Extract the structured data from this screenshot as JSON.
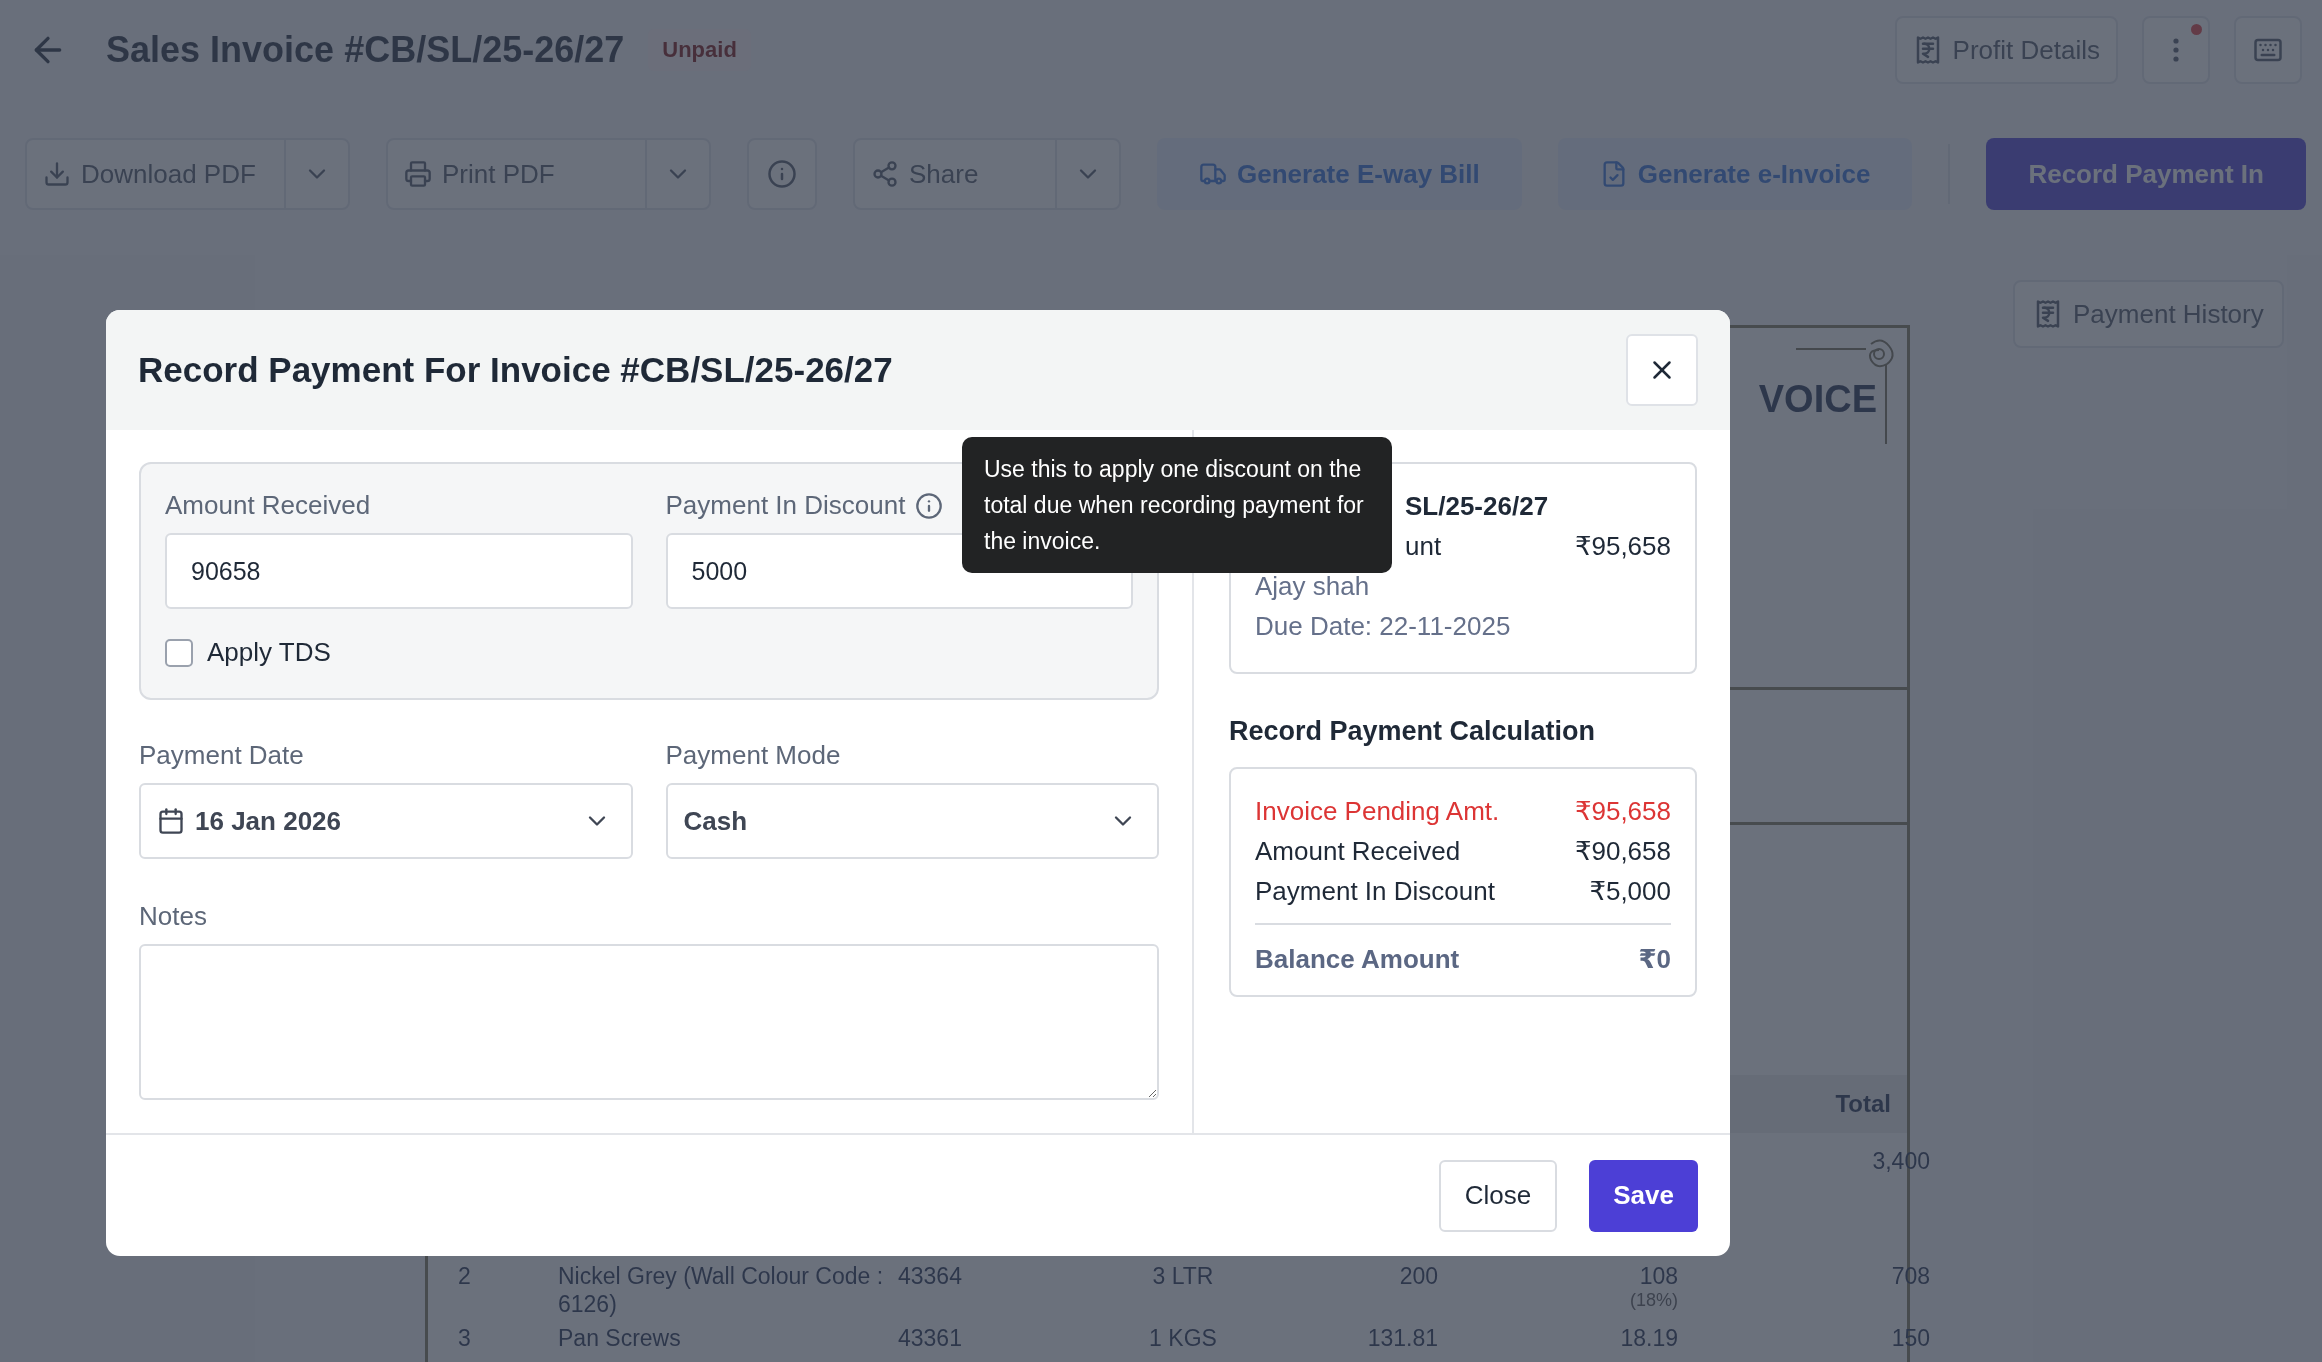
{
  "header": {
    "title": "Sales Invoice #CB/SL/25-26/27",
    "status": "Unpaid",
    "actions": [
      {
        "kind": "labeled",
        "label": "Profit Details"
      },
      {
        "kind": "more",
        "notification": true
      },
      {
        "kind": "keyboard"
      }
    ]
  },
  "toolbar": [
    {
      "kind": "split",
      "label": "Download PDF"
    },
    {
      "kind": "split",
      "label": "Print PDF"
    },
    {
      "kind": "icon"
    },
    {
      "kind": "split",
      "label": "Share"
    },
    {
      "kind": "soft",
      "label": "Generate E-way Bill"
    },
    {
      "kind": "soft",
      "label": "Generate e-Invoice"
    },
    {
      "kind": "primary",
      "label": "Record Payment In"
    }
  ],
  "side_button": {
    "label": "Payment History"
  },
  "document": {
    "title_fragment": "VOICE",
    "total_column": "Total",
    "rows": [
      {
        "total": "3,400"
      },
      {
        "index": "2",
        "item": "Nickel Grey (Wall Colour Code : 6126)",
        "hsn": "43364",
        "quantity": "3 LTR",
        "rate": "200",
        "tax": "108",
        "tax_rate": "(18%)",
        "total": "708"
      },
      {
        "index": "3",
        "item": "Pan Screws",
        "hsn": "43361",
        "quantity": "1 KGS",
        "rate": "131.81",
        "tax": "18.19",
        "total": "150"
      }
    ]
  },
  "modal": {
    "title": "Record Payment For Invoice #CB/SL/25-26/27",
    "tooltip": "Use this to apply one discount on the total due when recording payment for the invoice.",
    "amount_received": {
      "label": "Amount Received",
      "value": "90658"
    },
    "payment_in_discount": {
      "label": "Payment In Discount",
      "value": "5000"
    },
    "apply_tds": {
      "label": "Apply TDS",
      "checked": false
    },
    "payment_date": {
      "label": "Payment Date",
      "value": "16 Jan 2026"
    },
    "payment_mode": {
      "label": "Payment Mode",
      "value": "Cash"
    },
    "notes": {
      "label": "Notes"
    },
    "invoice_summary": {
      "number_fragment": "SL/25-26/27",
      "amount_label_fragment": "unt",
      "amount": "₹95,658",
      "customer": "Ajay shah",
      "due_date": "Due Date: 22-11-2025"
    },
    "calculation": {
      "title": "Record Payment Calculation",
      "rows": [
        {
          "kind": "pending",
          "label": "Invoice Pending Amt.",
          "value": "₹95,658"
        },
        {
          "kind": "plain",
          "label": "Amount Received",
          "value": "₹90,658"
        },
        {
          "kind": "plain",
          "label": "Payment In Discount",
          "value": "₹5,000"
        }
      ],
      "balance": {
        "label": "Balance Amount",
        "value": "₹0"
      }
    },
    "buttons": [
      {
        "kind": "secondary",
        "label": "Close"
      },
      {
        "kind": "primary",
        "label": "Save"
      }
    ]
  }
}
